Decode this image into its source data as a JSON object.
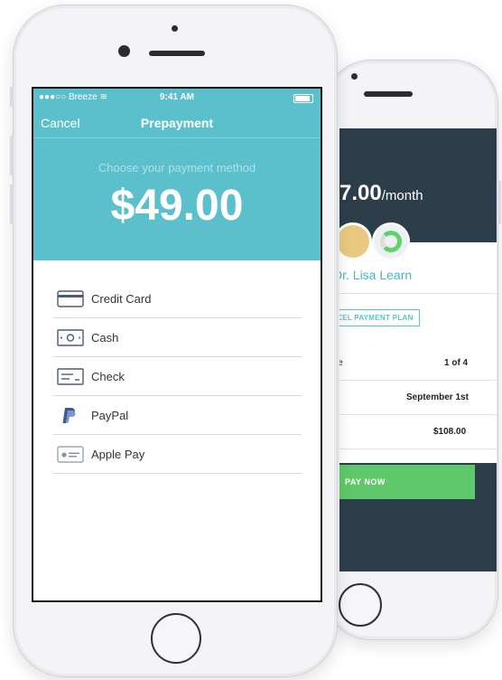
{
  "status_bar": {
    "carrier": "●●●○○ Breeze ≋",
    "time": "9:41 AM"
  },
  "nav": {
    "cancel": "Cancel",
    "title": "Prepayment"
  },
  "payment": {
    "prompt": "Choose your payment method",
    "amount": "$49.00"
  },
  "methods": [
    {
      "label": "Credit Card",
      "icon": "credit-card-icon"
    },
    {
      "label": "Cash",
      "icon": "cash-icon"
    },
    {
      "label": "Check",
      "icon": "check-icon"
    },
    {
      "label": "PayPal",
      "icon": "paypal-icon"
    },
    {
      "label": "Apple Pay",
      "icon": "apple-pay-icon"
    }
  ],
  "back_screen": {
    "price": "7.00",
    "per": "/month",
    "doctor": "Dr. Lisa Learn",
    "cancel_plan": "CEL PAYMENT PLAN",
    "rows": [
      {
        "label": "le",
        "value": "1 of 4"
      },
      {
        "label": "",
        "value": "September 1st"
      },
      {
        "label": "",
        "value": "$108.00"
      }
    ],
    "pay_now": "PAY NOW"
  },
  "colors": {
    "teal": "#5bc0cc",
    "green": "#5fc86a",
    "dark": "#2c3e4a"
  }
}
